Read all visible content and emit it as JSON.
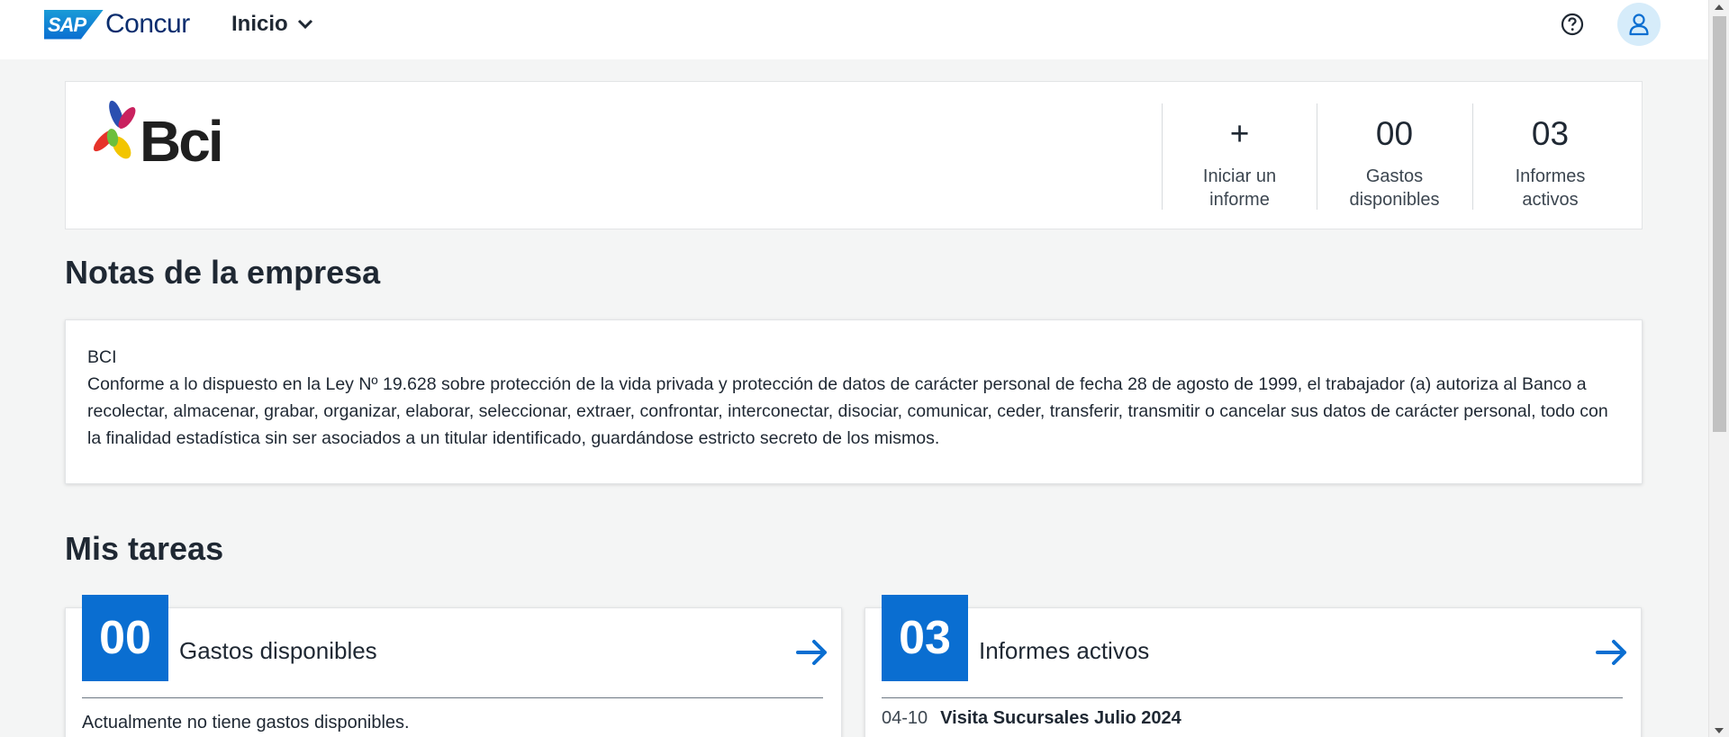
{
  "topbar": {
    "brand_sap": "SAP",
    "brand_name": "Concur",
    "nav_label": "Inicio"
  },
  "header": {
    "logo_text": "Bci",
    "stats": [
      {
        "value": "+",
        "label_line1": "Iniciar un",
        "label_line2": "informe"
      },
      {
        "value": "00",
        "label_line1": "Gastos",
        "label_line2": "disponibles"
      },
      {
        "value": "03",
        "label_line1": "Informes",
        "label_line2": "activos"
      }
    ]
  },
  "notes": {
    "title": "Notas de la empresa",
    "company": "BCI",
    "body": "Conforme a lo dispuesto en la Ley Nº 19.628 sobre protección de la vida privada y protección de datos de carácter personal de fecha 28 de agosto de 1999, el trabajador (a) autoriza al Banco a recolectar, almacenar, grabar, organizar, elaborar, seleccionar, extraer, confrontar, interconectar, disociar, comunicar, ceder, transferir, transmitir o cancelar sus datos de carácter personal, todo con la finalidad estadística sin ser asociados a un titular identificado, guardándose estricto secreto de los mismos."
  },
  "tasks": {
    "title": "Mis tareas",
    "expenses": {
      "count": "00",
      "title": "Gastos disponibles",
      "empty_message": "Actualmente no tiene gastos disponibles."
    },
    "reports": {
      "count": "03",
      "title": "Informes activos",
      "items": [
        {
          "date": "04-10",
          "name": "Visita Sucursales Julio 2024"
        }
      ]
    }
  },
  "colors": {
    "accent": "#0a6ed1",
    "brand_navy": "#0a2d6e",
    "avatar_bg": "#d6ecfa"
  }
}
